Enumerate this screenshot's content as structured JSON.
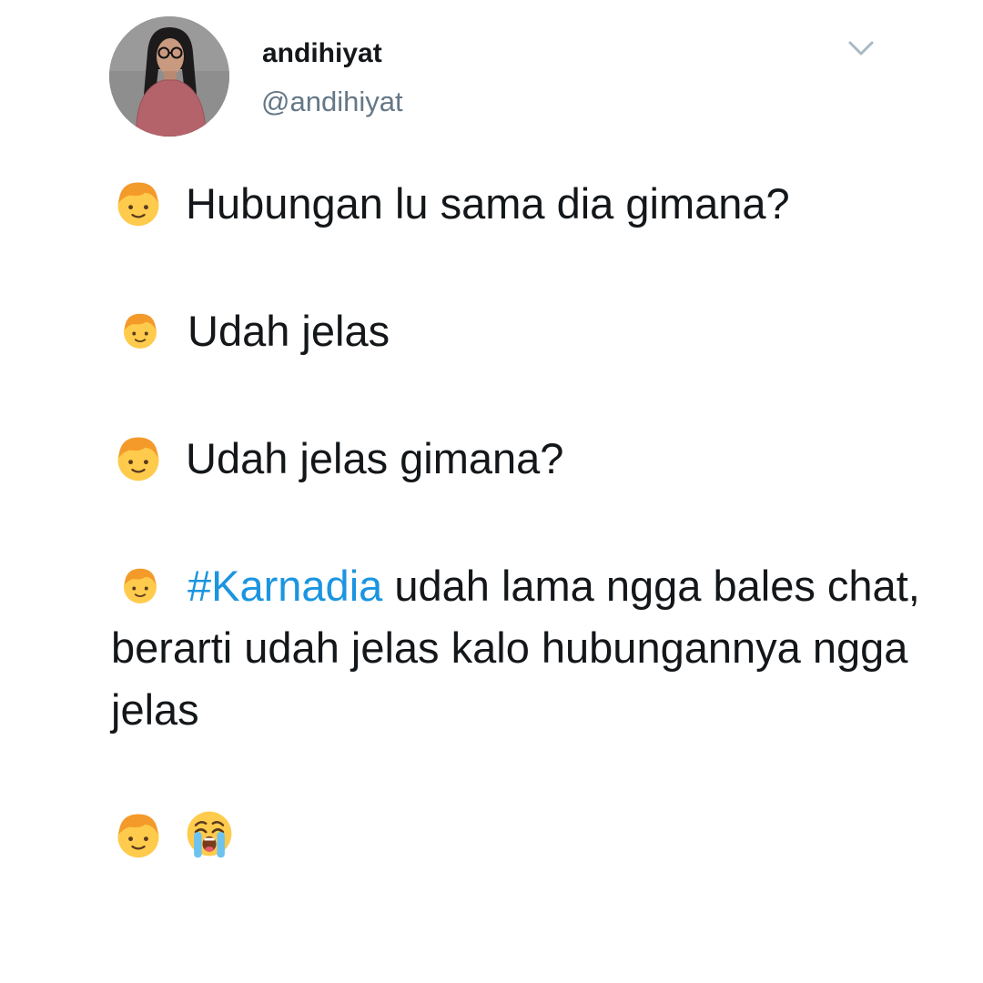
{
  "user": {
    "display_name": "andihiyat",
    "handle": "@andihiyat"
  },
  "icons": {
    "menu": "chevron-down-icon",
    "speaker": "boy-face-emoji",
    "reaction": "loudly-crying-face-emoji"
  },
  "tweet": {
    "line1": "Hubungan lu sama dia gimana?",
    "line2": "Udah jelas",
    "line3": "Udah jelas gimana?",
    "line4_hashtag": "#Karnadia",
    "line4_rest": " udah lama ngga bales chat, berarti udah jelas kalo hubungannya ngga jelas"
  },
  "colors": {
    "text": "#14171a",
    "handle": "#657786",
    "hashtag": "#1b95e0",
    "caret": "#aab8c2"
  }
}
